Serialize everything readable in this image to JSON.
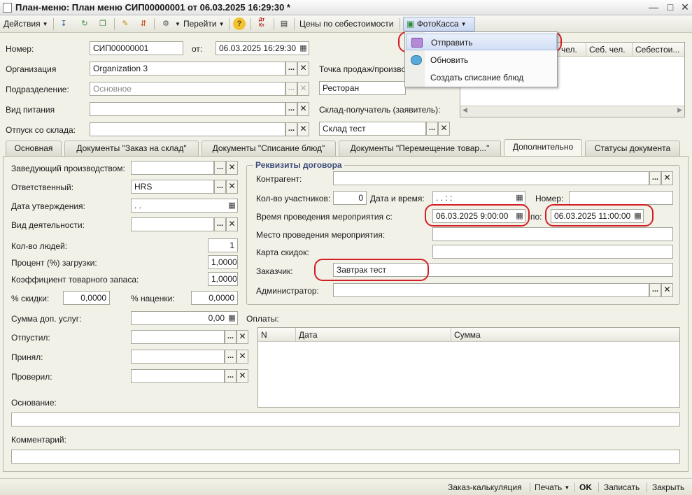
{
  "window": {
    "title": "План-меню: План меню СИП00000001 от 06.03.2025 16:29:30 *"
  },
  "toolbar": {
    "actions_label": "Действия",
    "goto_label": "Перейти",
    "cost_prices_label": "Цены по себестоимости",
    "fotokassa_label": "ФотоКасса",
    "dtkt_label": "Дт Кт"
  },
  "fotokassa_menu": {
    "items": [
      {
        "label": "Отправить",
        "highlighted": true
      },
      {
        "label": "Обновить"
      },
      {
        "label": "Создать списание блюд"
      }
    ]
  },
  "header": {
    "number_label": "Номер:",
    "number_value": "СИП00000001",
    "from_label": "от:",
    "date_value": "06.03.2025 16:29:30",
    "org_label": "Организация",
    "org_value": "Organization 3",
    "point_of_sale_label": "Точка продаж/производства",
    "point_of_sale_value": "Ресторан",
    "subdivision_label": "Подразделение:",
    "subdivision_value": "Основное",
    "meal_type_label": "Вид питания",
    "receiver_warehouse_label": "Склад-получатель (заявитель):",
    "receiver_warehouse_value": "Склад тест",
    "release_warehouse_label": "Отпуск со склада:"
  },
  "top_grid": {
    "columns": [
      "чел.",
      "Себ. чел.",
      "Себестои..."
    ]
  },
  "tabs": [
    {
      "label": "Основная"
    },
    {
      "label": "Документы \"Заказ на склад\""
    },
    {
      "label": "Документы \"Списание блюд\""
    },
    {
      "label": "Документы \"Перемещение товар...\""
    },
    {
      "label": "Дополнительно",
      "active": true
    },
    {
      "label": "Статусы документа"
    }
  ],
  "left_form": {
    "head_of_production_label": "Заведующий производством:",
    "responsible_label": "Ответственный:",
    "responsible_value": "HRS",
    "approval_date_label": "Дата утверждения:",
    "approval_date_value": " .  .",
    "activity_type_label": "Вид деятельности:",
    "people_count_label": "Кол-во людей:",
    "people_count_value": "1",
    "load_percent_label": "Процент (%) загрузки:",
    "load_percent_value": "1,0000",
    "stock_coef_label": "Коэффициент товарного запаса:",
    "stock_coef_value": "1,0000",
    "discount_label": "% скидки:",
    "discount_value": "0,0000",
    "markup_label": "% наценки:",
    "markup_value": "0,0000",
    "extra_services_label": "Сумма доп. услуг:",
    "extra_services_value": "0,00",
    "released_by_label": "Отпустил:",
    "accepted_by_label": "Принял:",
    "checked_by_label": "Проверил:",
    "basis_label": "Основание:",
    "comment_label": "Комментарий:"
  },
  "contract": {
    "title": "Реквизиты договора",
    "counterparty_label": "Контрагент:",
    "participants_label": "Кол-во участников:",
    "participants_value": "0",
    "datetime_label": "Дата и время:",
    "datetime_value": " .  .      :  :",
    "number_label": "Номер:",
    "event_time_label": "Время проведения мероприятия с:",
    "event_from_value": "06.03.2025  9:00:00",
    "to_label": "по:",
    "event_to_value": "06.03.2025 11:00:00",
    "venue_label": "Место проведения мероприятия:",
    "discount_card_label": "Карта скидок:",
    "customer_label": "Заказчик:",
    "customer_value": "Завтрак тест",
    "admin_label": "Администратор:"
  },
  "payments": {
    "label": "Оплаты:",
    "columns": [
      "N",
      "Дата",
      "Сумма"
    ]
  },
  "bottom": {
    "calc_label": "Заказ-калькуляция",
    "print_label": "Печать",
    "ok_label": "OK",
    "save_label": "Записать",
    "close_label": "Закрыть"
  }
}
